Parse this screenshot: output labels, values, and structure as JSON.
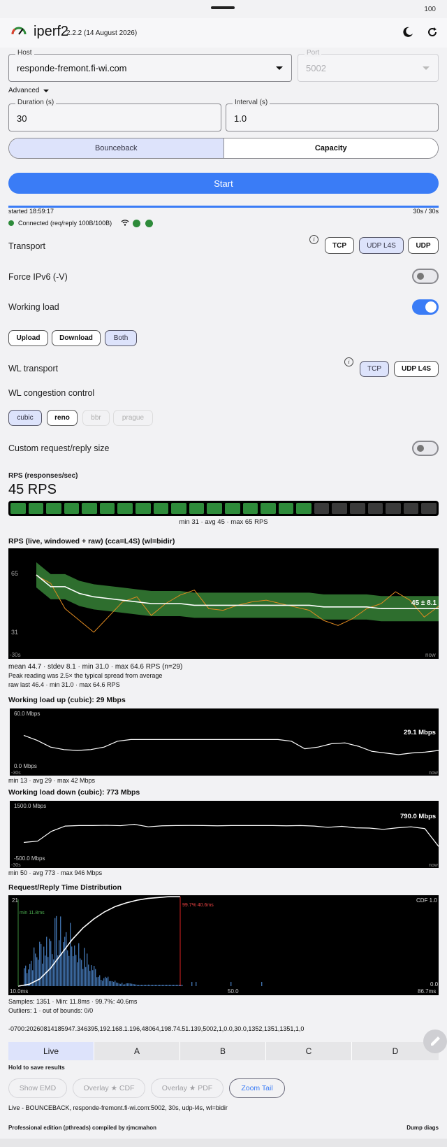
{
  "status": {
    "battery": "100"
  },
  "app": {
    "title": "iperf2",
    "version": "2.2.2 (14 August 2026)"
  },
  "host": {
    "label": "Host",
    "value": "responde-fremont.fi-wi.com"
  },
  "port": {
    "label": "Port",
    "value": "5002"
  },
  "advanced_label": "Advanced",
  "duration": {
    "label": "Duration (s)",
    "value": "30"
  },
  "interval": {
    "label": "Interval (s)",
    "value": "1.0"
  },
  "mode": {
    "bounceback": "Bounceback",
    "capacity": "Capacity"
  },
  "start_label": "Start",
  "progress": {
    "started": "started 18:59:17",
    "elapsed": "30s / 30s",
    "fraction": 1.0,
    "connected": "Connected (req/reply 100B/100B)"
  },
  "transport": {
    "label": "Transport",
    "options": [
      "TCP",
      "UDP L4S",
      "UDP"
    ]
  },
  "force_ipv6": {
    "label": "Force IPv6 (-V)"
  },
  "working_load": {
    "label": "Working load",
    "directions": [
      "Upload",
      "Download",
      "Both"
    ]
  },
  "wl_transport": {
    "label": "WL transport",
    "options": [
      "TCP",
      "UDP L4S"
    ]
  },
  "wl_cc": {
    "label": "WL congestion control",
    "options": [
      "cubic",
      "reno",
      "bbr",
      "prague"
    ]
  },
  "custom_size": {
    "label": "Custom request/reply size"
  },
  "rps": {
    "label": "RPS (responses/sec)",
    "value": "45 RPS",
    "lit_segments": 17,
    "total_segments": 24,
    "summary": "min 31 · avg 45 · max 65 RPS"
  },
  "rps_chart": {
    "title": "RPS (live, windowed + raw) (cca=L4S) (wl=bidir)",
    "tick_top": "65",
    "tick_bottom": "31",
    "x_left": "-30s",
    "x_right": "now",
    "badge": "45 ± 8.1",
    "stats1": "mean 44.7 · stdev 8.1 · min 31.0 · max 64.6 RPS (n=29)",
    "stats2": "Peak reading was 2.5× the typical spread from average",
    "stats3": "raw last 46.4 · min 31.0 · max 64.6 RPS"
  },
  "up_chart": {
    "title": "Working load up (cubic): 29 Mbps",
    "top": "60.0 Mbps",
    "bottom": "0.0 Mbps",
    "x_left": "-30s",
    "x_right": "now",
    "badge": "29.1 Mbps",
    "summary": "min 13 · avg 29 · max 42 Mbps"
  },
  "down_chart": {
    "title": "Working load down (cubic): 773 Mbps",
    "top": "1500.0 Mbps",
    "bottom": "-500.0 Mbps",
    "x_left": "-30s",
    "x_right": "now",
    "badge": "790.0 Mbps",
    "summary": "min 50 · avg 773 · max 946 Mbps"
  },
  "dist_chart": {
    "title": "Request/Reply Time Distribution",
    "y_top": "21",
    "min_label": "min 11.8ms",
    "p997_label": "99.7% 40.6ms",
    "cdf_label": "CDF 1.0",
    "cdf_zero": "0.0",
    "x_left": "10.0ms",
    "x_mid": "50.0",
    "x_right": "86.7ms",
    "samples": "Samples: 1351 · Min: 11.8ms · 99.7%: 40.6ms",
    "outliers": "Outliers: 1 · out of bounds: 0/0"
  },
  "csv_line": "-0700:20260814185947.346395,192.168.1.196,48064,198.74.51.139,5002,1,0.0,30.0,1352,1351,1351,1,0",
  "tabs": [
    "Live",
    "A",
    "B",
    "C",
    "D"
  ],
  "hold_hint": "Hold to save results",
  "actions": [
    "Show EMD",
    "Overlay ★ CDF",
    "Overlay ★ PDF",
    "Zoom Tail"
  ],
  "run_summary": "Live - BOUNCEBACK, responde-fremont.fi-wi.com:5002, 30s, udp-l4s, wl=bidir",
  "footer": {
    "edition": "Professional edition (pthreads) compiled by rjmcmahon",
    "dump": "Dump diags"
  },
  "colors": {
    "accent": "#3a7cf6",
    "green": "#2e8b3a",
    "chart_bg": "#000000"
  },
  "series": {
    "rps_windowed": [
      65,
      58,
      58,
      54,
      52,
      51,
      50,
      49,
      48,
      48,
      48,
      47,
      47,
      47,
      47,
      47,
      47,
      47,
      47,
      47,
      46,
      46,
      46,
      46,
      45,
      45,
      45,
      45,
      45
    ],
    "rps_raw": [
      64.6,
      60,
      45,
      38,
      31,
      40,
      49,
      52,
      41,
      48,
      53,
      56,
      45,
      44,
      47,
      49,
      50,
      48,
      46,
      44,
      38,
      35,
      39,
      45,
      48,
      55,
      50,
      40,
      46.4
    ],
    "wl_up": [
      38,
      32,
      24,
      21,
      20,
      21,
      24,
      31,
      33,
      33,
      33,
      33,
      33,
      33,
      33,
      33,
      33,
      33,
      33,
      33,
      31,
      22,
      24,
      28,
      29,
      25,
      19,
      17,
      15,
      17,
      18,
      20
    ],
    "wl_down": [
      180,
      230,
      620,
      830,
      850,
      850,
      860,
      845,
      900,
      800,
      840,
      850,
      855,
      850,
      840,
      850,
      850,
      850,
      850,
      840,
      850,
      830,
      780,
      820,
      760,
      750,
      700,
      760,
      800,
      730,
      20
    ],
    "dist_cdf": [
      0,
      0.02,
      0.08,
      0.2,
      0.36,
      0.52,
      0.65,
      0.75,
      0.83,
      0.89,
      0.93,
      0.96,
      0.98,
      0.99,
      1,
      1
    ]
  }
}
